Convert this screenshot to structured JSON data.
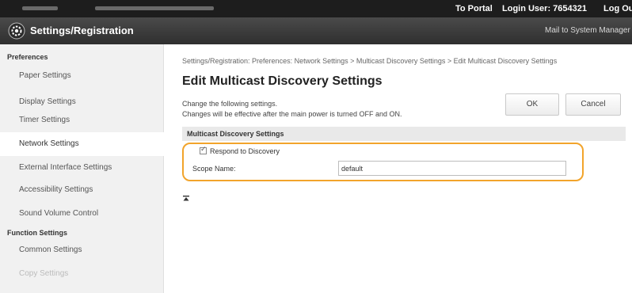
{
  "topbar": {
    "portal_label": "To Portal",
    "login_label": "Login User:  7654321",
    "logout_label": "Log Out"
  },
  "appbar": {
    "icon": "gear-icon",
    "title": "Settings/Registration",
    "mail_label": "Mail to System Manager"
  },
  "sidebar": {
    "sections": [
      {
        "heading": "Preferences"
      },
      {
        "heading": "Function Settings"
      }
    ],
    "items": [
      {
        "label": "Paper Settings"
      },
      {
        "label": "Display Settings"
      },
      {
        "label": "Timer Settings"
      },
      {
        "label": "Network Settings",
        "active": true
      },
      {
        "label": "External Interface Settings"
      },
      {
        "label": "Accessibility Settings"
      },
      {
        "label": "Sound Volume Control"
      },
      {
        "label": "Common Settings"
      },
      {
        "label": "Copy Settings"
      }
    ]
  },
  "main": {
    "breadcrumb": "Settings/Registration: Preferences: Network Settings > Multicast Discovery Settings > Edit Multicast Discovery Settings",
    "title": "Edit Multicast Discovery Settings",
    "description_line1": "Change the following settings.",
    "description_line2": "Changes will be effective after the main power is turned OFF and ON.",
    "ok_label": "OK",
    "cancel_label": "Cancel",
    "section_title": "Multicast Discovery Settings",
    "respond_checkbox_label": "Respond to Discovery",
    "respond_checked": true,
    "scope_label": "Scope Name:",
    "scope_value": "default",
    "back_to_top_icon": "arrow-to-top-icon"
  },
  "colors": {
    "highlight": "#f2a42b",
    "topbar": "#1d1d1d",
    "appbar": "#3a3a3a"
  }
}
